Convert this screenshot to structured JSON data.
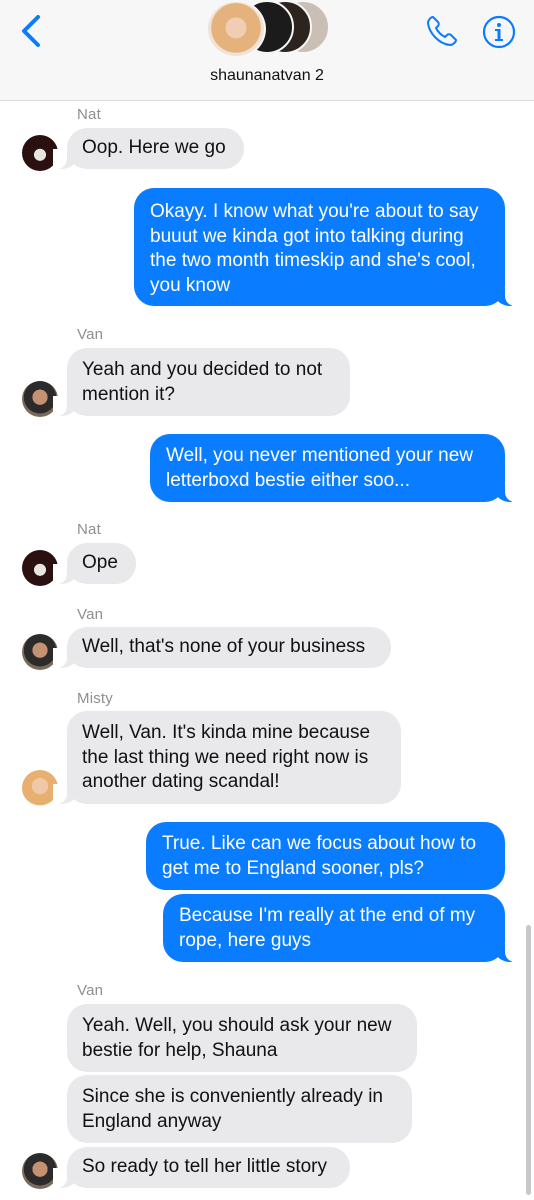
{
  "header": {
    "group_name": "shaunanatvan 2",
    "back_icon": "chevron-left-icon",
    "call_icon": "phone-icon",
    "info_icon": "info-icon",
    "accent_color": "#0a7cff"
  },
  "messages": [
    {
      "sender": "Nat",
      "text": "Oop. Here we go",
      "direction": "in"
    },
    {
      "text": "Okayy. I know what you're about to say buuut we kinda got into talking during the two month timeskip and she's cool, you know",
      "direction": "out"
    },
    {
      "sender": "Van",
      "text": "Yeah and you decided to not mention it?",
      "direction": "in"
    },
    {
      "text": "Well, you never mentioned your new letterboxd bestie either soo...",
      "direction": "out"
    },
    {
      "sender": "Nat",
      "text": "Ope",
      "direction": "in"
    },
    {
      "sender": "Van",
      "text": "Well, that's none of your business",
      "direction": "in"
    },
    {
      "sender": "Misty",
      "text": "Well, Van. It's kinda mine because the last thing we need right now is another dating scandal!",
      "direction": "in"
    },
    {
      "text": "True. Like can we focus about how to get me to England sooner, pls?",
      "direction": "out"
    },
    {
      "text": "Because I'm really at the end of my rope, here guys",
      "direction": "out"
    },
    {
      "sender": "Van",
      "text": "Yeah. Well, you should ask your new bestie for help, Shauna",
      "direction": "in"
    },
    {
      "text": "Since she is conveniently already in England anyway",
      "direction": "in"
    },
    {
      "text": "So ready to tell her little story",
      "direction": "in"
    }
  ]
}
